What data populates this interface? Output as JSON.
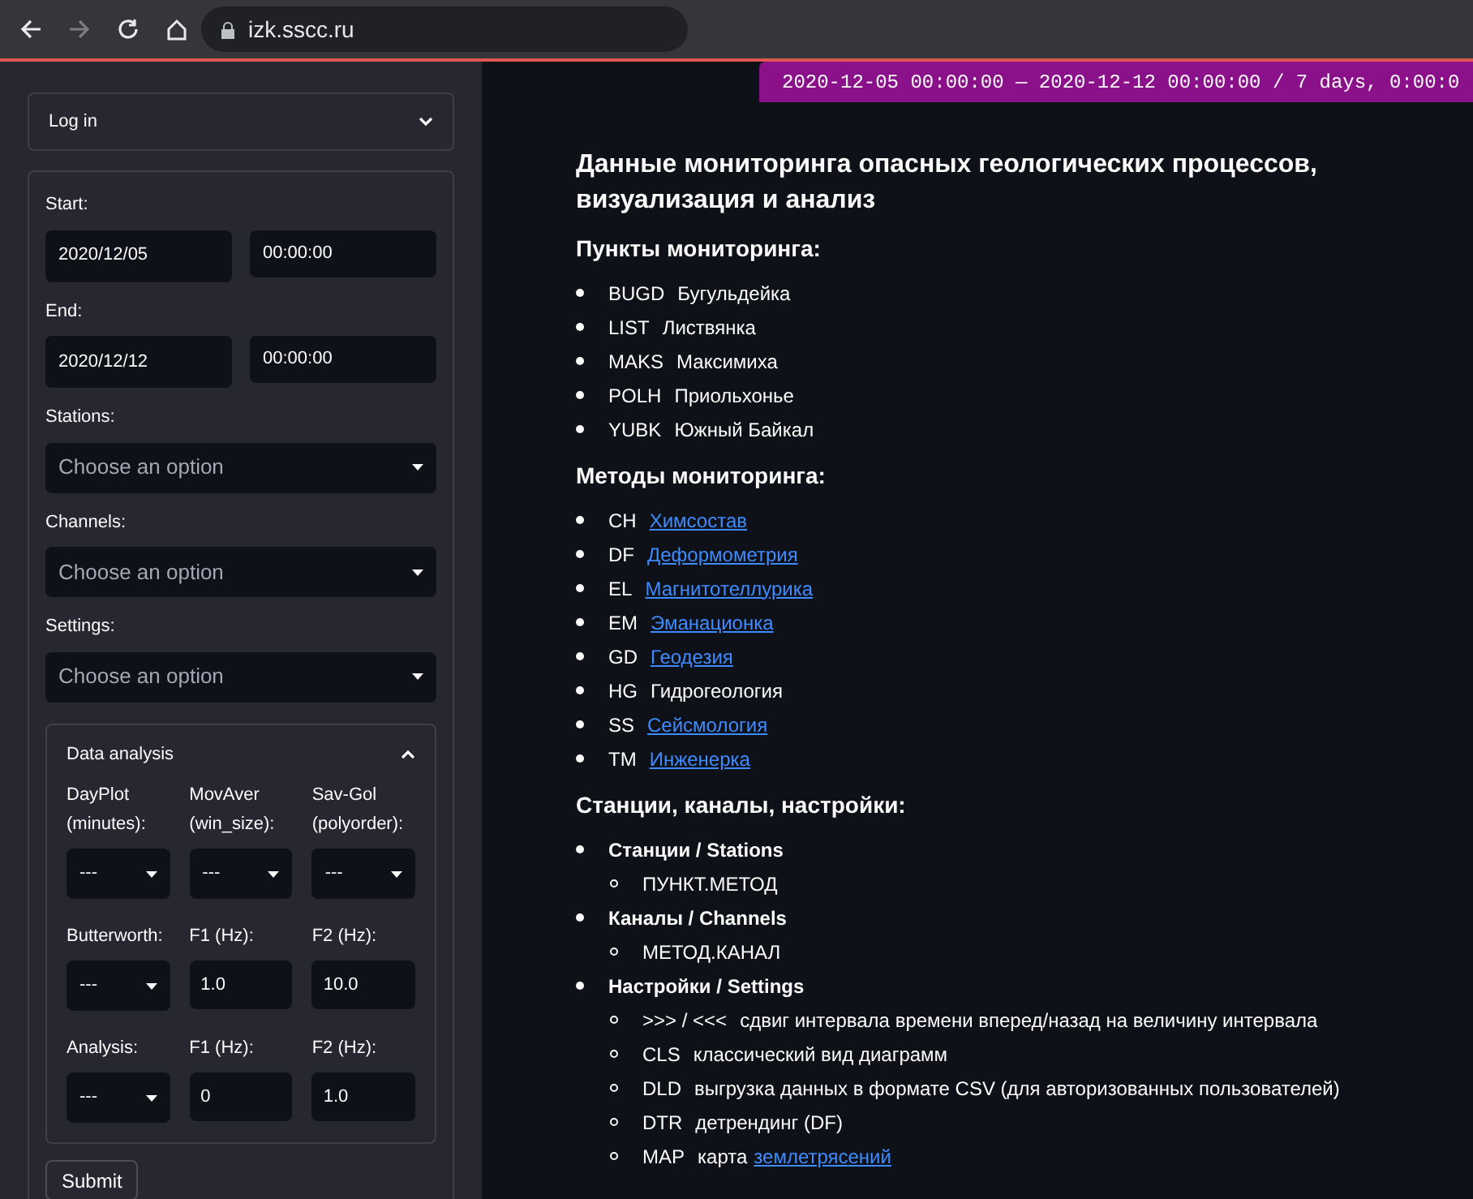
{
  "browser": {
    "url": "izk.sscc.ru",
    "forward_enabled": false
  },
  "sidebar": {
    "login": {
      "label": "Log in",
      "expanded": false
    },
    "start": {
      "label": "Start:",
      "date": "2020/12/05",
      "time": "00:00:00"
    },
    "end": {
      "label": "End:",
      "date": "2020/12/12",
      "time": "00:00:00"
    },
    "selects": [
      {
        "label": "Stations:",
        "placeholder": "Choose an option"
      },
      {
        "label": "Channels:",
        "placeholder": "Choose an option"
      },
      {
        "label": "Settings:",
        "placeholder": "Choose an option"
      }
    ],
    "analysis": {
      "title": "Data analysis",
      "expanded": true,
      "rows": [
        [
          {
            "kind": "select",
            "label": "DayPlot (minutes):",
            "value": "---"
          },
          {
            "kind": "select",
            "label": "MovAver (win_size):",
            "value": "---"
          },
          {
            "kind": "select",
            "label": "Sav-Gol (polyorder):",
            "value": "---"
          }
        ],
        [
          {
            "kind": "select",
            "label": "Butterworth:",
            "value": "---"
          },
          {
            "kind": "input",
            "label": "F1 (Hz):",
            "value": "1.0"
          },
          {
            "kind": "input",
            "label": "F2 (Hz):",
            "value": "10.0"
          }
        ],
        [
          {
            "kind": "select",
            "label": "Analysis:",
            "value": "---"
          },
          {
            "kind": "input",
            "label": "F1 (Hz):",
            "value": "0"
          },
          {
            "kind": "input",
            "label": "F2 (Hz):",
            "value": "1.0"
          }
        ]
      ]
    },
    "submit": "Submit"
  },
  "main": {
    "range_badge": "2020-12-05 00:00:00 — 2020-12-12 00:00:00 / 7 days, 0:00:0",
    "title": "Данные мониторинга опасных геологических процессов, визуализация и анализ",
    "points": {
      "heading": "Пункты мониторинга:",
      "items": [
        {
          "code": "BUGD",
          "name": "Бугульдейка"
        },
        {
          "code": "LIST",
          "name": "Листвянка"
        },
        {
          "code": "MAKS",
          "name": "Максимиха"
        },
        {
          "code": "POLH",
          "name": "Приольхонье"
        },
        {
          "code": "YUBK",
          "name": "Южный Байкал"
        }
      ]
    },
    "methods": {
      "heading": "Методы мониторинга:",
      "items": [
        {
          "code": "CH",
          "name": "Химсостав",
          "link": true
        },
        {
          "code": "DF",
          "name": "Деформометрия",
          "link": true
        },
        {
          "code": "EL",
          "name": "Магнитотеллурика",
          "link": true
        },
        {
          "code": "EM",
          "name": "Эманационка",
          "link": true
        },
        {
          "code": "GD",
          "name": "Геодезия",
          "link": true
        },
        {
          "code": "HG",
          "name": "Гидрогеология",
          "link": false
        },
        {
          "code": "SS",
          "name": "Сейсмология",
          "link": true
        },
        {
          "code": "TM",
          "name": "Инженерка",
          "link": true
        }
      ]
    },
    "config": {
      "heading": "Станции, каналы, настройки:",
      "items": [
        {
          "title": "Станции / Stations",
          "children": [
            {
              "code": "ПУНКТ.МЕТОД"
            }
          ]
        },
        {
          "title": "Каналы / Channels",
          "children": [
            {
              "code": "МЕТОД.КАНАЛ"
            }
          ]
        },
        {
          "title": "Настройки / Settings",
          "children": [
            {
              "code": ">>> / <<<",
              "text": "сдвиг интервала времени вперед/назад на величину интервала"
            },
            {
              "code": "CLS",
              "text": "классический вид диаграмм"
            },
            {
              "code": "DLD",
              "text": "выгрузка данных в формате CSV (для авторизованных пользователей)"
            },
            {
              "code": "DTR",
              "text": "детрендинг (DF)"
            },
            {
              "code": "MAP",
              "text": "карта",
              "link": "землетрясений"
            }
          ]
        }
      ]
    }
  }
}
